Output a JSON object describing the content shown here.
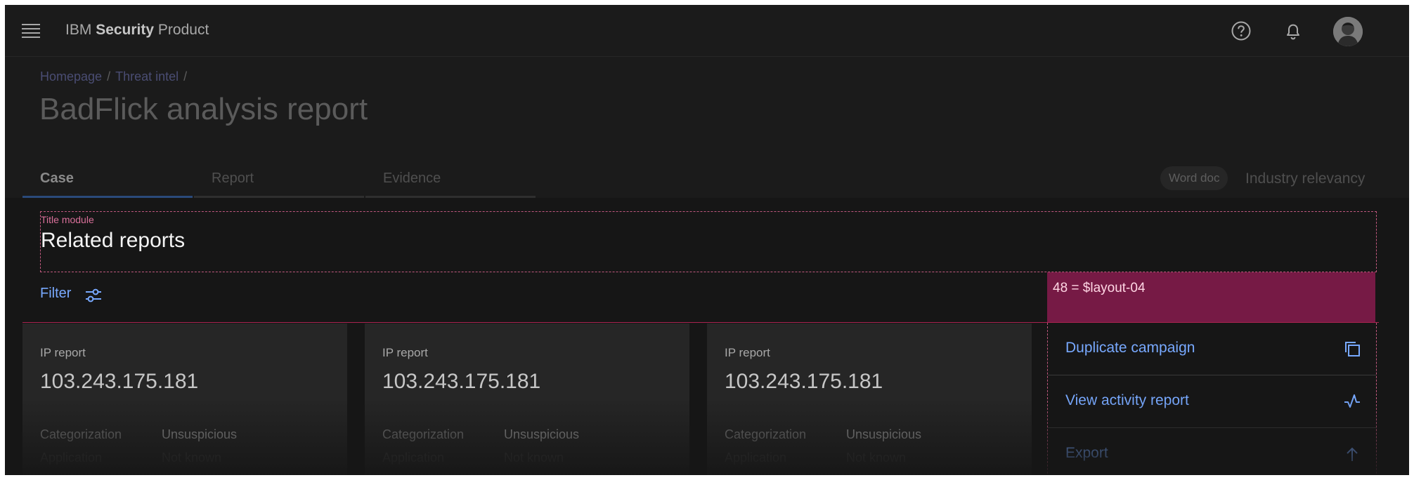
{
  "header": {
    "brand_prefix": "IBM",
    "brand_bold": "Security",
    "brand_suffix": "Product",
    "icons": [
      "menu-icon",
      "help-icon",
      "notification-icon",
      "avatar"
    ]
  },
  "page": {
    "breadcrumb": [
      "Homepage",
      "Threat intel"
    ],
    "breadcrumb_separator": "/",
    "title": "BadFlick analysis report",
    "tabs": [
      {
        "label": "Case",
        "active": true
      },
      {
        "label": "Report",
        "active": false
      },
      {
        "label": "Evidence",
        "active": false
      }
    ],
    "tag_label": "Word doc",
    "tag_right": "Industry relevancy"
  },
  "module": {
    "label": "Title module",
    "title": "Related reports",
    "filter_label": "Filter",
    "spacing_note": "48 = $layout-04"
  },
  "cards": [
    {
      "kind": "IP report",
      "ip": "103.243.175.181",
      "key": "Categorization",
      "value": "Unsuspicious",
      "key2": "Application",
      "value2": "Not known"
    },
    {
      "kind": "IP report",
      "ip": "103.243.175.181",
      "key": "Categorization",
      "value": "Unsuspicious",
      "key2": "Application",
      "value2": "Not known"
    },
    {
      "kind": "IP report",
      "ip": "103.243.175.181",
      "key": "Categorization",
      "value": "Unsuspicious",
      "key2": "Application",
      "value2": "Not known"
    }
  ],
  "actions": [
    {
      "label": "Duplicate campaign",
      "icon": "copy-icon"
    },
    {
      "label": "View activity report",
      "icon": "activity-icon"
    },
    {
      "label": "Export",
      "icon": "arrow-up-icon"
    }
  ],
  "colors": {
    "accent_link": "#78a9ff",
    "spec_pink": "#c0587e",
    "spec_fill": "#761a45",
    "background": "#161616"
  }
}
